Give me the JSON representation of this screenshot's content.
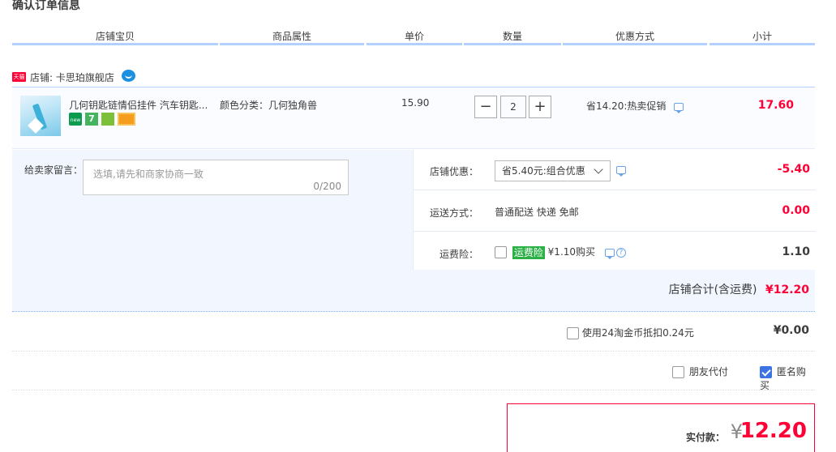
{
  "page_title": "确认订单信息",
  "columns": [
    "店铺宝贝",
    "商品属性",
    "单价",
    "数量",
    "优惠方式",
    "小计"
  ],
  "shop": {
    "badge": "天猫",
    "label": "店铺: 卡思珀旗舰店"
  },
  "item": {
    "title": "几何钥匙链情侣挂件 汽车钥匙...",
    "services": [
      "new",
      "7",
      "bag",
      "card"
    ],
    "service_7": "7",
    "service_new": "new",
    "attr": "颜色分类：几何独角兽",
    "price": "15.90",
    "qty": "2",
    "promo": "省14.20:热卖促销",
    "subtotal": "17.60"
  },
  "message": {
    "label": "给卖家留言：",
    "placeholder": "选填,请先和商家协商一致",
    "count": "0/200"
  },
  "shop_promo": {
    "label": "店铺优惠：",
    "selected": "省5.40元:组合优惠",
    "amount": "-5.40"
  },
  "shipping": {
    "label": "运送方式：",
    "value": "普通配送 快递 免邮",
    "amount": "0.00"
  },
  "insurance": {
    "label": "运费险：",
    "tag": "运费险",
    "text": "¥1.10购买",
    "amount": "1.10",
    "help": "?"
  },
  "shop_total": {
    "label": "店铺合计(含运费)",
    "amount": "¥12.20"
  },
  "coins": {
    "label": "使用24淘金币抵扣0.24元",
    "amount": "¥0.00"
  },
  "friend_pay": {
    "label": "朋友代付",
    "checked": false
  },
  "anon_buy": {
    "label": "匿名购买",
    "checked": true
  },
  "payment": {
    "label": "实付款：",
    "currency": "¥",
    "amount": "12.20"
  },
  "colors": {
    "accent": "#ff0036",
    "header_border": "#b2d1ff",
    "panel_bg": "#f2f7ff",
    "checkbox_blue": "#3b73e5",
    "insurance_green": "#2ab045"
  }
}
